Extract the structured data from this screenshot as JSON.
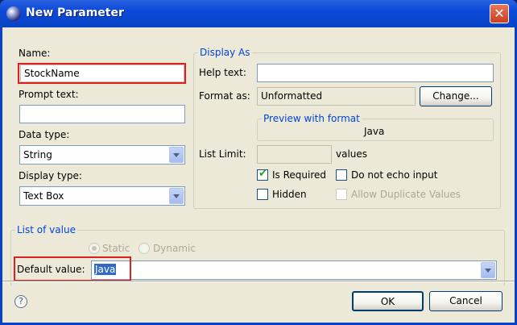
{
  "window": {
    "title": "New Parameter",
    "close_glyph": "✕"
  },
  "left": {
    "name_label": "Name:",
    "name_value": "StockName",
    "prompt_label": "Prompt text:",
    "prompt_value": "",
    "data_type_label": "Data type:",
    "data_type_value": "String",
    "display_type_label": "Display type:",
    "display_type_value": "Text Box"
  },
  "display_as": {
    "legend": "Display As",
    "help_label": "Help text:",
    "help_value": "",
    "format_label": "Format as:",
    "format_value": "Unformatted",
    "change_button": "Change...",
    "preview_legend": "Preview with format",
    "preview_value": "Java",
    "list_limit_label": "List Limit:",
    "list_limit_value": "",
    "values_label": "values",
    "is_required_label": "Is Required",
    "is_required_checked": true,
    "no_echo_label": "Do not echo input",
    "no_echo_checked": false,
    "hidden_label": "Hidden",
    "hidden_checked": false,
    "allow_dup_label": "Allow Duplicate Values",
    "allow_dup_checked": false
  },
  "list_of_value": {
    "legend": "List of value",
    "static_label": "Static",
    "dynamic_label": "Dynamic",
    "selected": "Static",
    "default_label": "Default value:",
    "default_value": "Java"
  },
  "footer": {
    "help_glyph": "?",
    "ok_button": "OK",
    "cancel_button": "Cancel"
  },
  "colors": {
    "titlebar": "#0a4ad8",
    "client_bg": "#ece9d8",
    "highlight": "#e0201f",
    "legend_text": "#0046d5"
  },
  "icons": {
    "app": "eclipse-icon",
    "close": "close-icon",
    "help": "help-icon",
    "dropdown": "chevron-down-icon"
  }
}
